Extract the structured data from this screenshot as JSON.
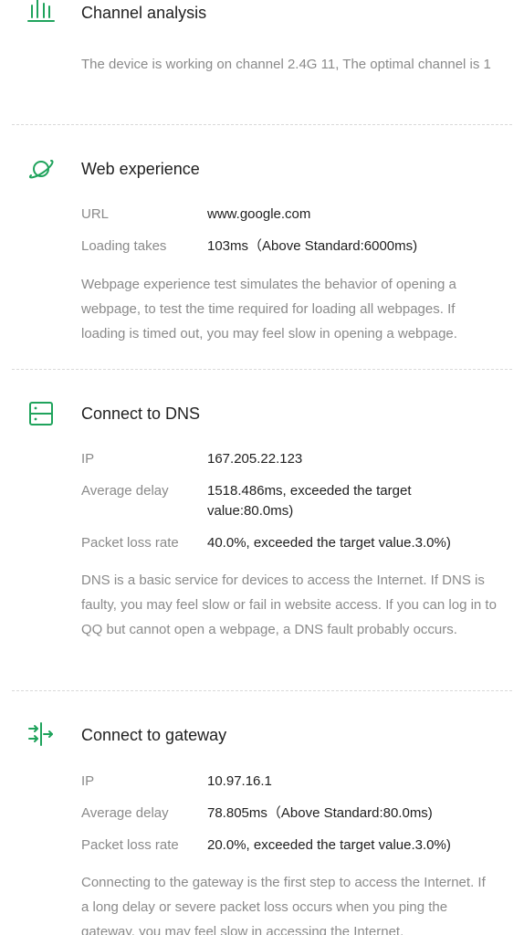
{
  "colors": {
    "accent": "#1fa35c"
  },
  "channel": {
    "icon": "bar-chart-icon",
    "title": "Channel analysis",
    "description": "The device is working on channel 2.4G 11, The optimal channel is 1"
  },
  "web": {
    "icon": "planet-icon",
    "title": "Web experience",
    "rows": [
      {
        "label": "URL",
        "value": "www.google.com"
      },
      {
        "label": "Loading takes",
        "value": "103ms（Above Standard:6000ms)"
      }
    ],
    "description": "Webpage experience test simulates the behavior of opening a webpage, to test the time required for loading all webpages. If loading is timed out, you may feel slow in opening a webpage."
  },
  "dns": {
    "icon": "server-icon",
    "title": "Connect to DNS",
    "rows": [
      {
        "label": "IP",
        "value": "167.205.22.123"
      },
      {
        "label": "Average delay",
        "value": "1518.486ms, exceeded the target value:80.0ms)"
      },
      {
        "label": "Packet loss rate",
        "value": "40.0%, exceeded the target value.3.0%)"
      }
    ],
    "description": "DNS is a basic service for devices to access the Internet. If DNS is faulty, you may feel slow or fail in website access. If you can log in to QQ but cannot open a webpage, a DNS fault probably occurs."
  },
  "gateway": {
    "icon": "gateway-arrows-icon",
    "title": "Connect to gateway",
    "rows": [
      {
        "label": "IP",
        "value": "10.97.16.1"
      },
      {
        "label": "Average delay",
        "value": "78.805ms（Above Standard:80.0ms)"
      },
      {
        "label": "Packet loss rate",
        "value": "20.0%, exceeded the target value.3.0%)"
      }
    ],
    "description": "Connecting to the gateway is the first step to access the Internet. If a long delay or severe packet loss occurs when you ping the gateway, you may feel slow in accessing the Internet."
  }
}
